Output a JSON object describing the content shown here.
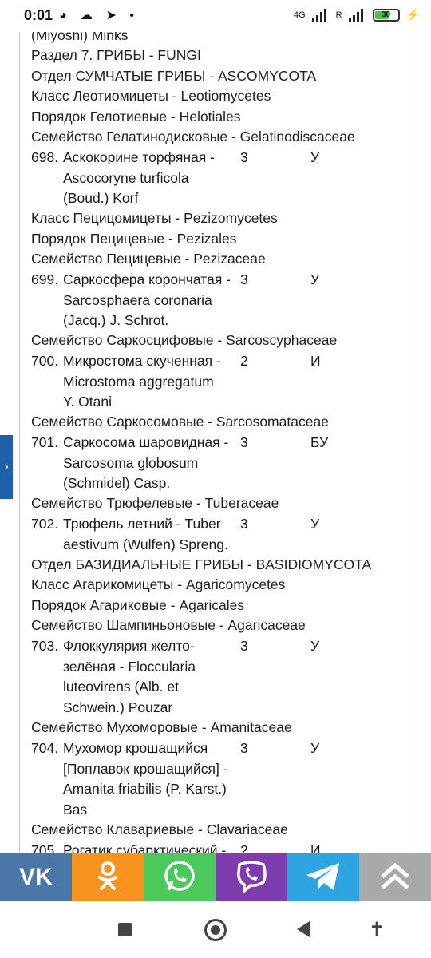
{
  "status": {
    "time": "0:01",
    "net1": "4G",
    "net2": "R",
    "battery": "30"
  },
  "document": {
    "top_partial": "(Miyoshi) Minks",
    "headers": {
      "h1": "Раздел 7. ГРИБЫ - FUNGI",
      "h2": "Отдел СУМЧАТЫЕ ГРИБЫ - ASCOMYCOTA",
      "h3": "Класс Леотиомицеты - Leotiomycetes",
      "h4": "Порядок Гелотиевые - Helotiales",
      "h5": "Семейство Гелатинодисковые - Gelatinodiscaceae",
      "h6": "Класс Пецицомицеты - Pezizomycetes",
      "h7": "Порядок Пецицевые - Pezizales",
      "h8": "Семейство Пецицевые - Pezizaceae",
      "h9": "Семейство Саркосцифовые - Sarcoscyphaceae",
      "h10": "Семейство Саркосомовые - Sarcosomataceae",
      "h11": "Семейство Трюфелевые - Tuberaceae",
      "h12": "Отдел БАЗИДИАЛЬНЫЕ ГРИБЫ - BASIDIOMYCOTA",
      "h13": "Класс Агарикомицеты - Agaricomycetes",
      "h14": "Порядок Агариковые - Agaricales",
      "h15": "Семейство Шампиньоновые - Agaricaceae",
      "h16": "Семейство Мухоморовые - Amanitaceae",
      "h17": "Семейство Клавариевые - Clavariaceae"
    },
    "entries": [
      {
        "num": "698.",
        "l1": "Аскокорине торфяная -",
        "l2": "Ascocoryne turficola",
        "l3": "(Boud.) Korf",
        "l4": "",
        "cat": "3",
        "status": "У"
      },
      {
        "num": "699.",
        "l1": "Саркосфера корончатая -",
        "l2": "Sarcosphaera coronaria",
        "l3": "(Jacq.) J. Schrot.",
        "l4": "",
        "cat": "3",
        "status": "У"
      },
      {
        "num": "700.",
        "l1": "Микростома скученная -",
        "l2": "Microstoma aggregatum",
        "l3": "Y. Otani",
        "l4": "",
        "cat": "2",
        "status": "И"
      },
      {
        "num": "701.",
        "l1": "Саркосома шаровидная -",
        "l2": "Sarcosoma globosum",
        "l3": "(Schmidel) Casp.",
        "l4": "",
        "cat": "3",
        "status": "БУ"
      },
      {
        "num": "702.",
        "l1": "Трюфель летний - Tuber",
        "l2": "aestivum (Wulfen) Spreng.",
        "l3": "",
        "l4": "",
        "cat": "3",
        "status": "У"
      },
      {
        "num": "703.",
        "l1": "Флоккулярия желто-",
        "l2": "зелёная - Floccularia",
        "l3": "luteovirens (Alb. et",
        "l4": "Schwein.) Pouzar",
        "cat": "3",
        "status": "У"
      },
      {
        "num": "704.",
        "l1": "Мухомор крошащийся",
        "l2": "[Поплавок крошащийся] -",
        "l3": "Amanita friabilis (P. Karst.)",
        "l4": "Bas",
        "cat": "3",
        "status": "У"
      },
      {
        "num": "705.",
        "l1": "Рогатик субарктический -",
        "l2": "",
        "l3": "",
        "l4": "",
        "cat": "2",
        "status": "И"
      }
    ]
  },
  "share": {
    "vk_color": "#4a76a8",
    "ok_color": "#f7931e",
    "whatsapp_color": "#4bc95a",
    "viber_color": "#7d3daf",
    "telegram_color": "#2ca5e0",
    "up_color": "#a7a9ab"
  },
  "side_tab_glyph": "›"
}
